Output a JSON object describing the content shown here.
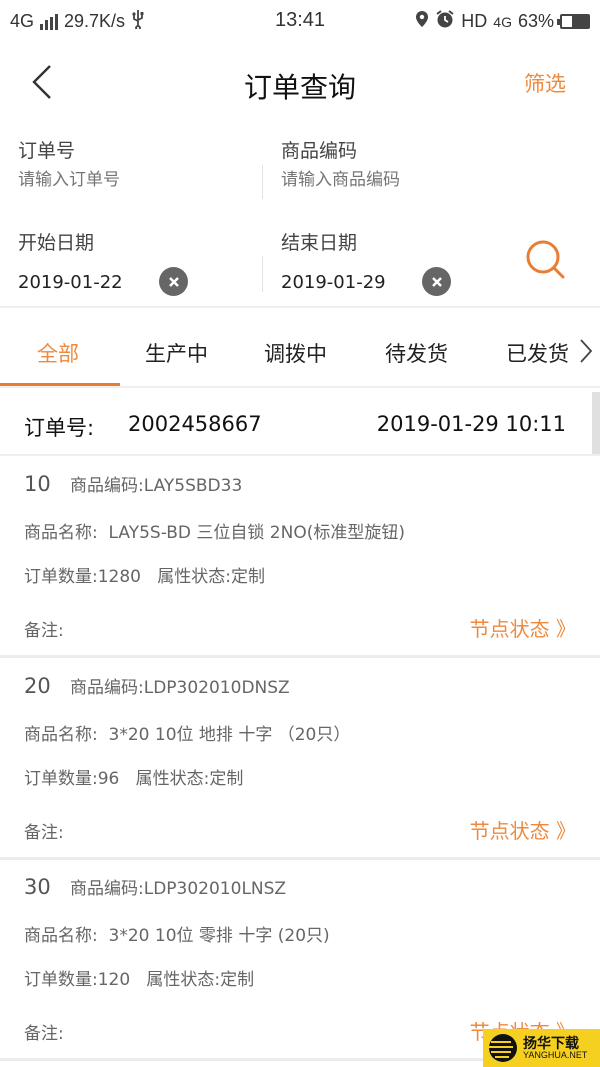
{
  "status_bar": {
    "network": "4G",
    "speed": "29.7K/s",
    "time": "13:41",
    "hd": "HD",
    "net_type": "4G",
    "battery": "63%",
    "icons": [
      "signal-icon",
      "usb-icon",
      "location-icon",
      "alarm-icon",
      "battery-icon"
    ]
  },
  "header": {
    "back_icon": "chevron-left-icon",
    "title": "订单查询",
    "filter_label": "筛选"
  },
  "search_form": {
    "order_no_label": "订单号",
    "order_no_placeholder": "请输入订单号",
    "order_no_value": "",
    "product_code_label": "商品编码",
    "product_code_placeholder": "请输入商品编码",
    "product_code_value": "",
    "start_date_label": "开始日期",
    "start_date_value": "2019-01-22",
    "end_date_label": "结束日期",
    "end_date_value": "2019-01-29",
    "clear_icon": "clear-circle-icon",
    "search_icon": "search-icon"
  },
  "tabs": {
    "items": [
      {
        "label": "全部",
        "active": true
      },
      {
        "label": "生产中",
        "active": false
      },
      {
        "label": "调拨中",
        "active": false
      },
      {
        "label": "待发货",
        "active": false
      },
      {
        "label": "已发货",
        "active": false
      }
    ],
    "more_icon": "chevron-right-icon"
  },
  "order": {
    "order_no_label": "订单号:",
    "order_no": "2002458667",
    "datetime": "2019-01-29 10:11",
    "items": [
      {
        "seq": "10",
        "code_label": "商品编码:",
        "code": "LAY5SBD33",
        "name_label": "商品名称:",
        "name": "LAY5S-BD 三位自锁 2NO(标准型旋钮)",
        "qty_label": "订单数量:",
        "qty": "1280",
        "attr_label": "属性状态:",
        "attr": "定制",
        "remark_label": "备注:",
        "remark": "",
        "node_status": "节点状态 》"
      },
      {
        "seq": "20",
        "code_label": "商品编码:",
        "code": "LDP302010DNSZ",
        "name_label": "商品名称:",
        "name": "3*20 10位 地排 十字 （20只）",
        "qty_label": "订单数量:",
        "qty": "96",
        "attr_label": "属性状态:",
        "attr": "定制",
        "remark_label": "备注:",
        "remark": "",
        "node_status": "节点状态 》"
      },
      {
        "seq": "30",
        "code_label": "商品编码:",
        "code": "LDP302010LNSZ",
        "name_label": "商品名称:",
        "name": "3*20 10位 零排 十字 (20只)",
        "qty_label": "订单数量:",
        "qty": "120",
        "attr_label": "属性状态:",
        "attr": "定制",
        "remark_label": "备注:",
        "remark": "",
        "node_status": "节点状态 》"
      }
    ]
  },
  "watermark": {
    "cn": "扬华下载",
    "en": "YANGHUA.NET"
  },
  "colors": {
    "accent": "#ee8a3e",
    "tab_underline": "#e97e33",
    "text_primary": "#222222",
    "text_secondary": "#666666",
    "placeholder": "#aaaaaa",
    "watermark_bg": "#f5d020"
  }
}
